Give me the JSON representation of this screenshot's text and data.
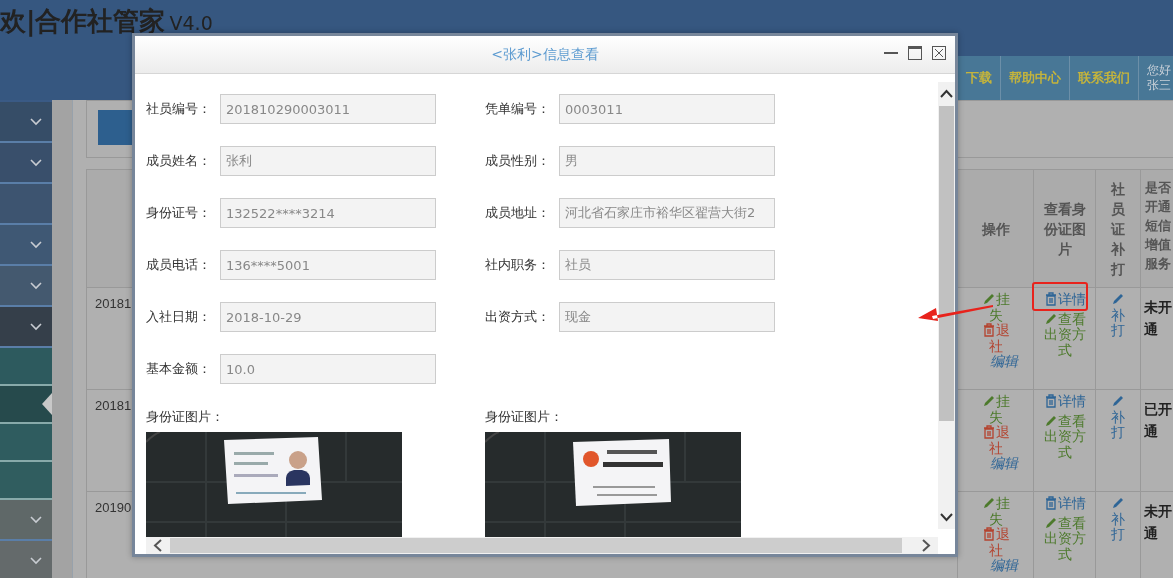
{
  "header": {
    "title": "欢|合作社管家",
    "version": "V4.0",
    "nav": [
      "下载",
      "帮助中心",
      "联系我们"
    ],
    "user": [
      "您好",
      "张三"
    ]
  },
  "sidebar": {
    "items": [
      {
        "kind": "group",
        "selected": false,
        "color": "#364d67"
      },
      {
        "kind": "group",
        "selected": false,
        "color": "#394f6b"
      },
      {
        "kind": "link",
        "selected": false,
        "color": "#3d5470"
      },
      {
        "kind": "group",
        "selected": false,
        "color": "#3f5874"
      },
      {
        "kind": "group",
        "selected": false,
        "color": "#44596f"
      },
      {
        "kind": "group",
        "selected": false,
        "color": "#353f4a"
      },
      {
        "kind": "link",
        "selected": false,
        "color": "#2d5a5e"
      },
      {
        "kind": "link",
        "selected": true,
        "color": "#264a4c"
      },
      {
        "kind": "link",
        "selected": false,
        "color": "#2f5c5f"
      },
      {
        "kind": "link",
        "selected": false,
        "color": "#305d5f"
      },
      {
        "kind": "group",
        "selected": false,
        "color": "#5f6868"
      },
      {
        "kind": "group",
        "selected": false,
        "color": "#646a6b"
      }
    ]
  },
  "table": {
    "columns": [
      "操作",
      "查看身份证图片",
      "社员证补打",
      "是否开通短信增值服务"
    ],
    "rows": [
      {
        "id": "20181",
        "actions": [
          {
            "kind": "loss",
            "label": "挂失"
          },
          {
            "kind": "withdraw",
            "label": "退社"
          },
          {
            "kind": "edit",
            "label": "编辑"
          }
        ],
        "photo": [
          {
            "kind": "details",
            "label": "详情"
          },
          {
            "kind": "funding",
            "label": "查看出资方式"
          }
        ],
        "reprint": "补打",
        "sms": "未开通"
      },
      {
        "id": "20181",
        "actions": [
          {
            "kind": "loss",
            "label": "挂失"
          },
          {
            "kind": "withdraw",
            "label": "退社"
          },
          {
            "kind": "edit",
            "label": "编辑"
          }
        ],
        "photo": [
          {
            "kind": "details",
            "label": "详情"
          },
          {
            "kind": "funding",
            "label": "查看出资方式"
          }
        ],
        "reprint": "补打",
        "sms": "已开通"
      },
      {
        "id": "20190",
        "actions": [
          {
            "kind": "loss",
            "label": "挂失"
          },
          {
            "kind": "withdraw",
            "label": "退社"
          },
          {
            "kind": "edit",
            "label": "编辑"
          }
        ],
        "photo": [
          {
            "kind": "details",
            "label": "详情"
          },
          {
            "kind": "funding",
            "label": "查看出资方式"
          }
        ],
        "reprint": "补打",
        "sms": "未开通"
      }
    ]
  },
  "dialog": {
    "title": "<张利>信息查看",
    "fields": [
      {
        "label": "社员编号：",
        "value": "201810290003011"
      },
      {
        "label": "凭单编号：",
        "value": "0003011"
      },
      {
        "label": "成员姓名：",
        "value": "张利"
      },
      {
        "label": "成员性别：",
        "value": "男"
      },
      {
        "label": "身份证号：",
        "value": "132522****3214"
      },
      {
        "label": "成员地址：",
        "value": "河北省石家庄市裕华区翟营大街2"
      },
      {
        "label": "成员电话：",
        "value": "136****5001"
      },
      {
        "label": "社内职务：",
        "value": "社员"
      },
      {
        "label": "入社日期：",
        "value": "2018-10-29"
      },
      {
        "label": "出资方式：",
        "value": "现金"
      },
      {
        "label": "基本金额：",
        "value": "10.0"
      }
    ],
    "images": [
      {
        "label": "身份证图片：",
        "kind": "front"
      },
      {
        "label": "身份证图片：",
        "kind": "back"
      }
    ]
  }
}
